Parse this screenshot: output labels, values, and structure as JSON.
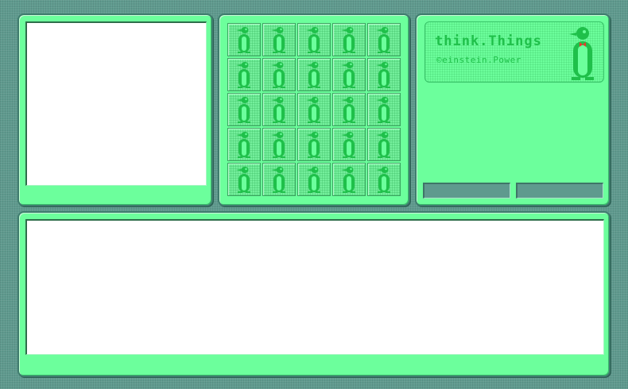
{
  "app": {
    "logo_title": "think.Things",
    "logo_subtitle": "©einstein.Power"
  },
  "preview": {
    "content": ""
  },
  "tiles": {
    "rows": 5,
    "cols": 5,
    "icon": "penguin-icon"
  },
  "buttons": {
    "left_label": "",
    "right_label": ""
  },
  "bottom": {
    "text": ""
  },
  "colors": {
    "background": "#5f9a8e",
    "panel": "#6cff9c",
    "accent_green": "#1fc04a",
    "bowtie": "#e83a2e",
    "white": "#ffffff"
  }
}
